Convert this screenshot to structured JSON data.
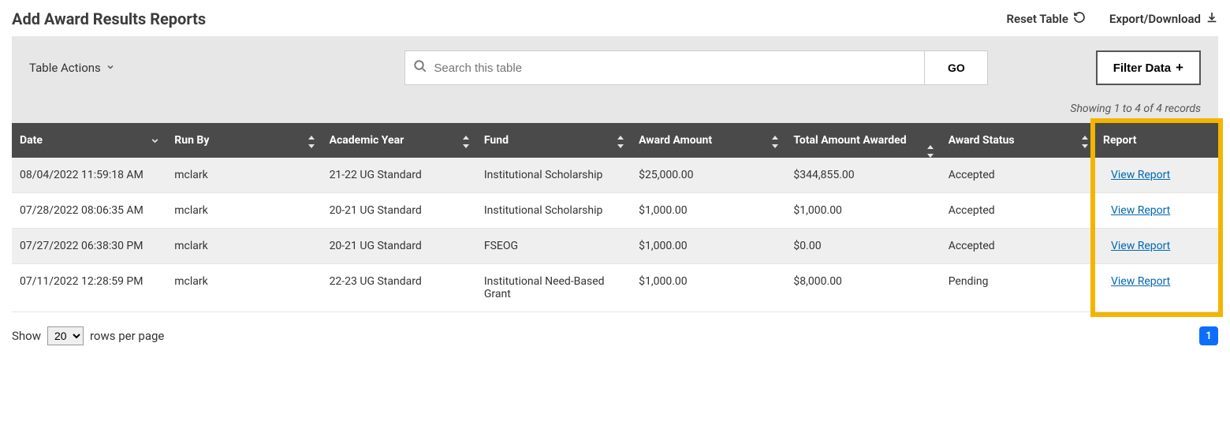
{
  "header": {
    "title": "Add Award Results Reports",
    "reset_label": "Reset Table",
    "export_label": "Export/Download"
  },
  "toolbar": {
    "table_actions_label": "Table Actions",
    "search_placeholder": "Search this table",
    "go_label": "GO",
    "filter_label": "Filter Data"
  },
  "records_note": "Showing 1 to 4 of 4 records",
  "columns": {
    "date": "Date",
    "run_by": "Run By",
    "academic_year": "Academic Year",
    "fund": "Fund",
    "award_amount": "Award Amount",
    "total_awarded": "Total Amount Awarded",
    "award_status": "Award Status",
    "report": "Report"
  },
  "rows": [
    {
      "date": "08/04/2022 11:59:18 AM",
      "run_by": "mclark",
      "academic_year": "21-22 UG Standard",
      "fund": "Institutional Scholarship",
      "award_amount": "$25,000.00",
      "total_awarded": "$344,855.00",
      "award_status": "Accepted",
      "report": "View Report"
    },
    {
      "date": "07/28/2022 08:06:35 AM",
      "run_by": "mclark",
      "academic_year": "20-21 UG Standard",
      "fund": "Institutional Scholarship",
      "award_amount": "$1,000.00",
      "total_awarded": "$1,000.00",
      "award_status": "Accepted",
      "report": "View Report"
    },
    {
      "date": "07/27/2022 06:38:30 PM",
      "run_by": "mclark",
      "academic_year": "20-21 UG Standard",
      "fund": "FSEOG",
      "award_amount": "$1,000.00",
      "total_awarded": "$0.00",
      "award_status": "Accepted",
      "report": "View Report"
    },
    {
      "date": "07/11/2022 12:28:59 PM",
      "run_by": "mclark",
      "academic_year": "22-23 UG Standard",
      "fund": "Institutional Need-Based Grant",
      "award_amount": "$1,000.00",
      "total_awarded": "$8,000.00",
      "award_status": "Pending",
      "report": "View Report"
    }
  ],
  "pager": {
    "show_label": "Show",
    "rows_label": "rows per page",
    "page_size": "20",
    "current_page": "1"
  }
}
